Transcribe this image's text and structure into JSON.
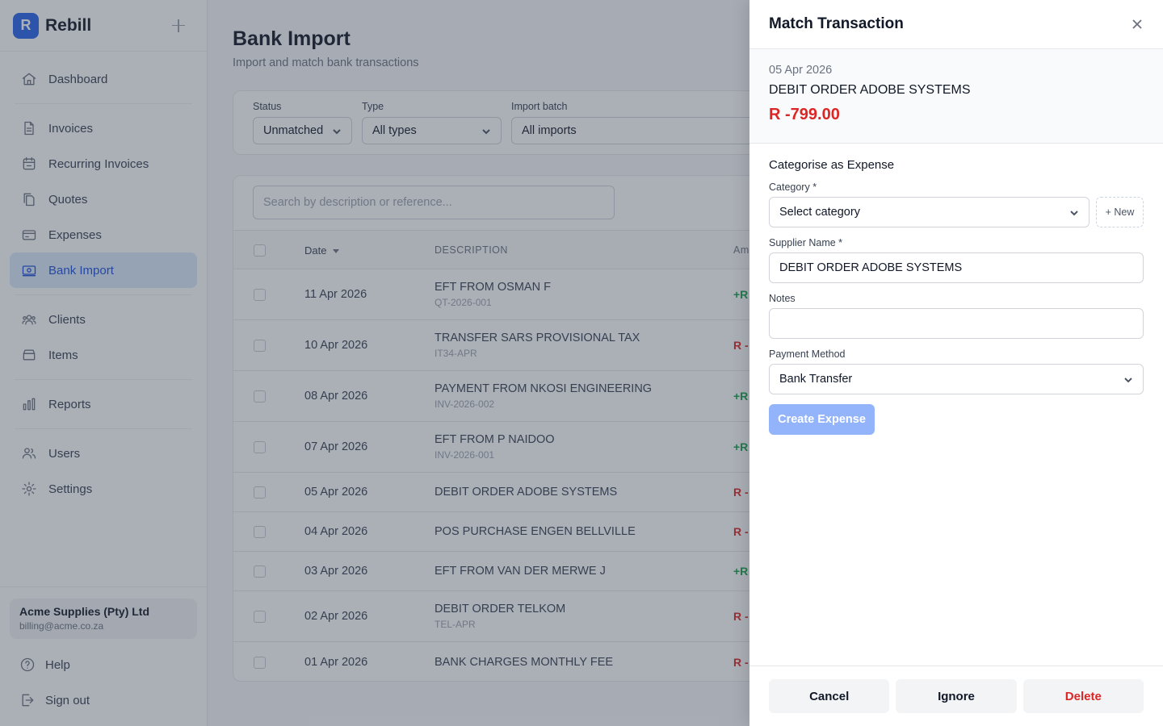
{
  "brand": {
    "logo_letter": "R",
    "name": "Rebill"
  },
  "sidebar": {
    "items": [
      {
        "label": "Dashboard",
        "icon": "home-icon"
      },
      {
        "label": "Invoices",
        "icon": "document-icon"
      },
      {
        "label": "Recurring Invoices",
        "icon": "calendar-icon"
      },
      {
        "label": "Quotes",
        "icon": "copy-document-icon"
      },
      {
        "label": "Expenses",
        "icon": "credit-card-icon"
      },
      {
        "label": "Bank Import",
        "icon": "banknote-icon",
        "active": true
      },
      {
        "label": "Clients",
        "icon": "users-group-icon"
      },
      {
        "label": "Items",
        "icon": "archive-box-icon"
      },
      {
        "label": "Reports",
        "icon": "bar-chart-icon"
      },
      {
        "label": "Users",
        "icon": "users-icon"
      },
      {
        "label": "Settings",
        "icon": "gear-icon"
      }
    ],
    "account": {
      "name": "Acme Supplies (Pty) Ltd",
      "email": "billing@acme.co.za"
    },
    "footer": {
      "help": "Help",
      "sign_out": "Sign out"
    }
  },
  "page": {
    "title": "Bank Import",
    "subtitle": "Import and match bank transactions"
  },
  "filters": {
    "status": {
      "label": "Status",
      "value": "Unmatched"
    },
    "type": {
      "label": "Type",
      "value": "All types"
    },
    "batch": {
      "label": "Import batch",
      "value": "All imports"
    }
  },
  "table": {
    "search_placeholder": "Search by description or reference...",
    "headers": {
      "date": "Date",
      "description": "DESCRIPTION",
      "amount": "Am"
    },
    "rows": [
      {
        "date": "11 Apr 2026",
        "description": "EFT FROM OSMAN F",
        "reference": "QT-2026-001",
        "amount": "+R",
        "sign": "pos"
      },
      {
        "date": "10 Apr 2026",
        "description": "TRANSFER SARS PROVISIONAL TAX",
        "reference": "IT34-APR",
        "amount": "R -",
        "sign": "neg"
      },
      {
        "date": "08 Apr 2026",
        "description": "PAYMENT FROM NKOSI ENGINEERING",
        "reference": "INV-2026-002",
        "amount": "+R",
        "sign": "pos"
      },
      {
        "date": "07 Apr 2026",
        "description": "EFT FROM P NAIDOO",
        "reference": "INV-2026-001",
        "amount": "+R",
        "sign": "pos"
      },
      {
        "date": "05 Apr 2026",
        "description": "DEBIT ORDER ADOBE SYSTEMS",
        "reference": "",
        "amount": "R -",
        "sign": "neg"
      },
      {
        "date": "04 Apr 2026",
        "description": "POS PURCHASE ENGEN BELLVILLE",
        "reference": "",
        "amount": "R -",
        "sign": "neg"
      },
      {
        "date": "03 Apr 2026",
        "description": "EFT FROM VAN DER MERWE J",
        "reference": "",
        "amount": "+R",
        "sign": "pos"
      },
      {
        "date": "02 Apr 2026",
        "description": "DEBIT ORDER TELKOM",
        "reference": "TEL-APR",
        "amount": "R -",
        "sign": "neg"
      },
      {
        "date": "01 Apr 2026",
        "description": "BANK CHARGES MONTHLY FEE",
        "reference": "",
        "amount": "R -",
        "sign": "neg"
      }
    ]
  },
  "drawer": {
    "title": "Match Transaction",
    "transaction": {
      "date": "05 Apr 2026",
      "description": "DEBIT ORDER ADOBE SYSTEMS",
      "amount": "R -799.00"
    },
    "section_title": "Categorise as Expense",
    "category": {
      "label": "Category *",
      "value": "Select category",
      "new_label": "+ New"
    },
    "supplier": {
      "label": "Supplier Name *",
      "value": "DEBIT ORDER ADOBE SYSTEMS"
    },
    "notes": {
      "label": "Notes",
      "value": ""
    },
    "payment_method": {
      "label": "Payment Method",
      "value": "Bank Transfer"
    },
    "create_label": "Create Expense",
    "buttons": {
      "cancel": "Cancel",
      "ignore": "Ignore",
      "delete": "Delete"
    }
  },
  "colors": {
    "accent": "#2563eb",
    "positive": "#16a34a",
    "negative": "#dc2626",
    "disabled_button": "#93b4fb"
  }
}
